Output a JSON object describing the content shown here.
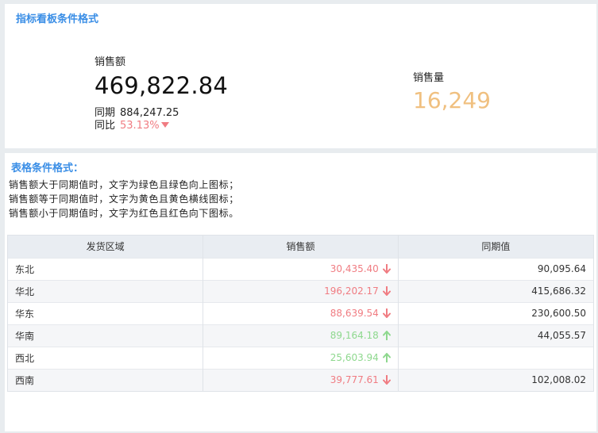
{
  "top_panel": {
    "title": "指标看板条件格式",
    "kpi_main_label": "销售额",
    "kpi_main_value": "469,822.84",
    "prev_label": "同期",
    "prev_value": "884,247.25",
    "ratio_label": "同比",
    "ratio_value": "53.13%",
    "ratio_trend": "down",
    "kpi_secondary_label": "销售量",
    "kpi_secondary_value": "16,249"
  },
  "bottom_panel": {
    "title": "表格条件格式：",
    "rules": [
      "销售额大于同期值时，文字为绿色且绿色向上图标；",
      "销售额等于同期值时，文字为黄色且黄色横线图标；",
      "销售额小于同期值时，文字为红色且红色向下图标。"
    ],
    "table": {
      "columns": [
        "发货区域",
        "销售额",
        "同期值"
      ],
      "rows": [
        {
          "region": "东北",
          "sales": "30,435.40",
          "trend": "down",
          "prev": "90,095.64"
        },
        {
          "region": "华北",
          "sales": "196,202.17",
          "trend": "down",
          "prev": "415,686.32"
        },
        {
          "region": "华东",
          "sales": "88,639.54",
          "trend": "down",
          "prev": "230,600.50"
        },
        {
          "region": "华南",
          "sales": "89,164.18",
          "trend": "up",
          "prev": "44,055.57"
        },
        {
          "region": "西北",
          "sales": "25,603.94",
          "trend": "up",
          "prev": ""
        },
        {
          "region": "西南",
          "sales": "39,777.61",
          "trend": "down",
          "prev": "102,008.02"
        }
      ]
    }
  },
  "colors": {
    "title_blue": "#3a8ee6",
    "down_red": "#f07c82",
    "up_green": "#8ed88e",
    "secondary_kpi": "#f0c080"
  }
}
